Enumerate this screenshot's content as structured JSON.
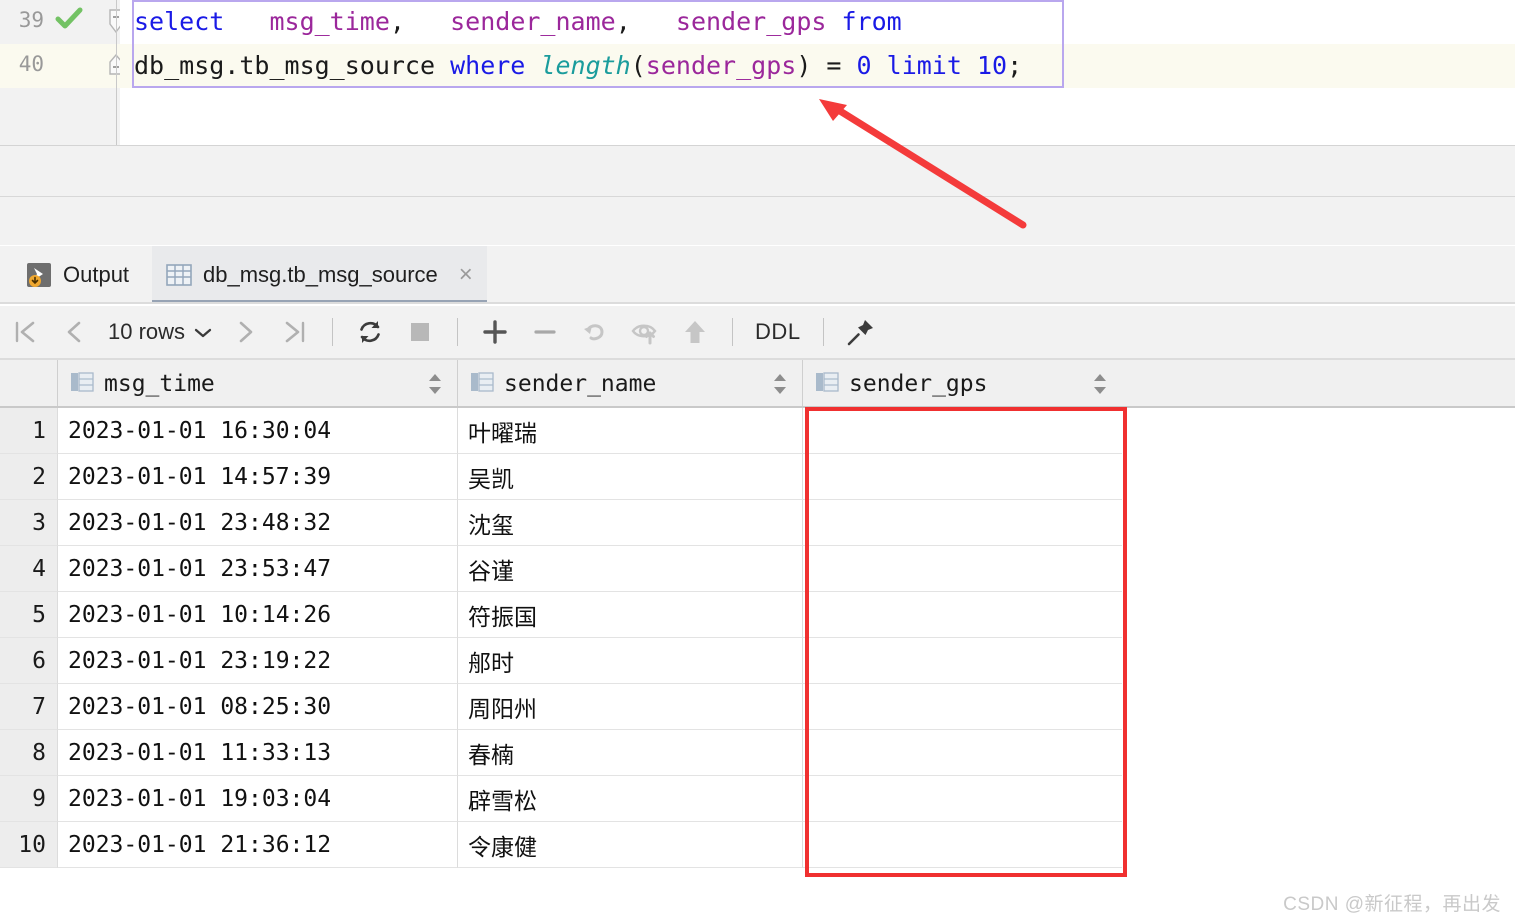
{
  "editor": {
    "lines": [
      {
        "number": "39",
        "has_check": true,
        "status_icon": "check-icon"
      },
      {
        "number": "40",
        "has_check": false,
        "status_icon": ""
      }
    ],
    "sql": {
      "line39": {
        "kw_select": "select",
        "gap1": "   ",
        "col_msg_time": "msg_time",
        "comma1": ",",
        "gap2": "   ",
        "col_sender_name": "sender_name",
        "comma2": ",",
        "gap3": "   ",
        "col_sender_gps": "sender_gps",
        "gap4": " ",
        "kw_from": "from"
      },
      "line40": {
        "table": "db_msg.tb_msg_source",
        "gap1": " ",
        "kw_where": "where",
        "gap2": " ",
        "fn_length": "length",
        "paren_open": "(",
        "col_sender_gps": "sender_gps",
        "paren_close": ")",
        "op_eq": " = ",
        "num_zero": "0",
        "gap3": " ",
        "kw_limit": "limit",
        "gap4": " ",
        "num_ten": "10",
        "semicolon": ";"
      }
    }
  },
  "tabs": [
    {
      "id": "output",
      "label": "Output",
      "icon": "output-console-icon",
      "active": false,
      "closable": false
    },
    {
      "id": "result",
      "label": "db_msg.tb_msg_source",
      "icon": "table-grid-icon",
      "active": true,
      "closable": true,
      "close_glyph": "×"
    }
  ],
  "toolbar": {
    "first_page": "first-page-icon",
    "prev_page": "previous-page-icon",
    "rows_label": "10 rows",
    "rows_dropdown": "chevron-down-icon",
    "next_page": "next-page-icon",
    "last_page": "last-page-icon",
    "refresh": "refresh-icon",
    "stop": "stop-icon",
    "add_row": "plus-icon",
    "delete_row": "minus-icon",
    "revert": "revert-undo-icon",
    "preview": "eye-upload-icon",
    "submit": "up-arrow-commit-icon",
    "ddl_label": "DDL",
    "pin": "pin-icon"
  },
  "grid": {
    "columns": [
      {
        "name": "msg_time",
        "icon": "column-table-icon",
        "sort": "sort-arrows-icon"
      },
      {
        "name": "sender_name",
        "icon": "column-table-icon",
        "sort": "sort-arrows-icon"
      },
      {
        "name": "sender_gps",
        "icon": "column-table-icon",
        "sort": "sort-arrows-icon"
      }
    ],
    "rows": [
      {
        "n": "1",
        "msg_time": "2023-01-01 16:30:04",
        "sender_name": "叶曜瑞",
        "sender_gps": ""
      },
      {
        "n": "2",
        "msg_time": "2023-01-01 14:57:39",
        "sender_name": "吴凯",
        "sender_gps": ""
      },
      {
        "n": "3",
        "msg_time": "2023-01-01 23:48:32",
        "sender_name": "沈玺",
        "sender_gps": ""
      },
      {
        "n": "4",
        "msg_time": "2023-01-01 23:53:47",
        "sender_name": "谷谨",
        "sender_gps": ""
      },
      {
        "n": "5",
        "msg_time": "2023-01-01 10:14:26",
        "sender_name": "符振国",
        "sender_gps": ""
      },
      {
        "n": "6",
        "msg_time": "2023-01-01 23:19:22",
        "sender_name": "郍时",
        "sender_gps": ""
      },
      {
        "n": "7",
        "msg_time": "2023-01-01 08:25:30",
        "sender_name": "周阳州",
        "sender_gps": ""
      },
      {
        "n": "8",
        "msg_time": "2023-01-01 11:33:13",
        "sender_name": "春楠",
        "sender_gps": ""
      },
      {
        "n": "9",
        "msg_time": "2023-01-01 19:03:04",
        "sender_name": "辟雪松",
        "sender_gps": ""
      },
      {
        "n": "10",
        "msg_time": "2023-01-01 21:36:12",
        "sender_name": "令康健",
        "sender_gps": ""
      }
    ]
  },
  "annotations": {
    "arrow": "red-arrow-annotation",
    "highlight_box": "red-highlight-rectangle"
  },
  "watermark": "CSDN @新征程，再出发",
  "colors": {
    "keyword": "#1a1ae6",
    "column": "#9b279b",
    "function": "#1a9c9c",
    "annotation_red": "#f03030",
    "check_green": "#73c264",
    "selection_border": "#b9a7ee",
    "active_line": "#fbfaef"
  }
}
